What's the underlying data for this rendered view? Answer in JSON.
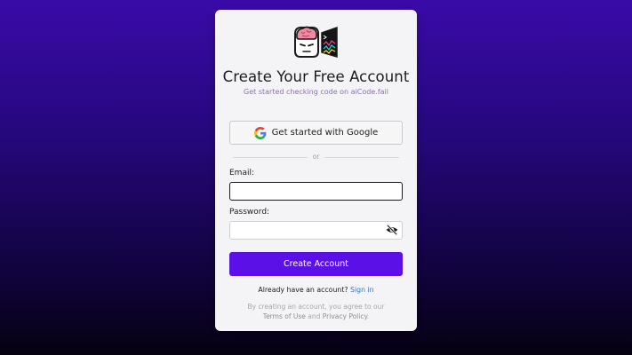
{
  "header": {
    "title": "Create Your Free Account",
    "subtitle": "Get started checking code on aiCode.fail",
    "logo_icon": "brain-robot-logo-icon"
  },
  "google": {
    "label": "Get started with Google",
    "icon": "google-g-icon"
  },
  "divider": {
    "text": "or"
  },
  "form": {
    "email_label": "Email:",
    "email_value": "",
    "password_label": "Password:",
    "password_value": "",
    "visibility_icon": "eye-slash-icon",
    "submit_label": "Create Account"
  },
  "signin": {
    "prompt": "Already have an account?",
    "link": "Sign in"
  },
  "terms": {
    "prefix": "By creating an account, you agree to our",
    "terms_link": "Terms of Use",
    "and": "and",
    "privacy_link": "Privacy Policy",
    "suffix": "."
  },
  "colors": {
    "accent": "#5b10e8",
    "link": "#2a78c8",
    "background_top": "#3a0aa8",
    "background_bottom": "#060112"
  }
}
